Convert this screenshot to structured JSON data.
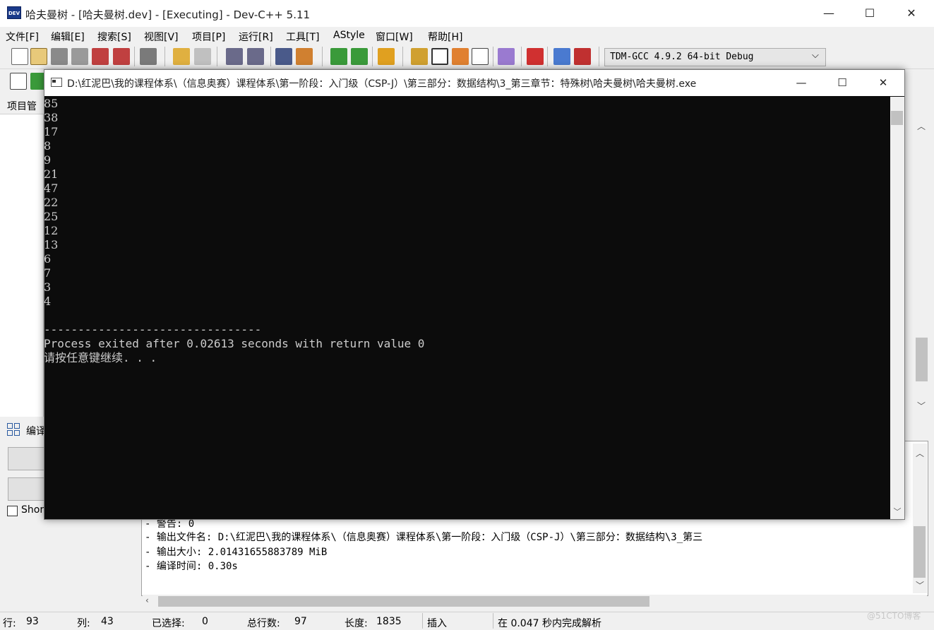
{
  "app": {
    "title": "哈夫曼树 - [哈夫曼树.dev] - [Executing] - Dev-C++ 5.11",
    "icon_text": "DEV"
  },
  "window_controls": {
    "minimize": "—",
    "maximize": "☐",
    "close": "✕"
  },
  "menu": [
    "文件[F]",
    "编辑[E]",
    "搜索[S]",
    "视图[V]",
    "项目[P]",
    "运行[R]",
    "工具[T]",
    "AStyle",
    "窗口[W]",
    "帮助[H]"
  ],
  "toolbar": {
    "compiler": "TDM-GCC 4.9.2 64-bit Debug"
  },
  "left_panel": {
    "project_tab": "项目管",
    "compile_log_tab": "编译",
    "short_checkbox": "Shor"
  },
  "console": {
    "title": "D:\\红泥巴\\我的课程体系\\（信息奥赛）课程体系\\第一阶段：入门级（CSP-J）\\第三部分：数据结构\\3_第三章节：特殊树\\哈夫曼树\\哈夫曼树.exe",
    "numbers": [
      "85",
      "38",
      "17",
      "8",
      "9",
      "21",
      "47",
      "22",
      "25",
      "12",
      "13",
      "6",
      "7",
      "3",
      "4"
    ],
    "separator": "--------------------------------",
    "process_line": "Process exited after 0.02613 seconds with return value 0",
    "press_key": "请按任意键继续. . ."
  },
  "compile_log": [
    "- 警告: 0",
    "- 输出文件名: D:\\红泥巴\\我的课程体系\\（信息奥赛）课程体系\\第一阶段：入门级（CSP-J）\\第三部分：数据结构\\3_第三",
    "- 输出大小: 2.01431655883789 MiB",
    "- 编译时间: 0.30s"
  ],
  "status": {
    "row_label": "行:",
    "row_value": "93",
    "col_label": "列:",
    "col_value": "43",
    "sel_label": "已选择:",
    "sel_value": "0",
    "lines_label": "总行数:",
    "lines_value": "97",
    "len_label": "长度:",
    "len_value": "1835",
    "mode": "插入",
    "parse": "在 0.047 秒内完成解析"
  },
  "watermark": "@51CTO博客",
  "colors": {
    "console_bg": "#0c0c0c",
    "console_fg": "#cccccc",
    "chrome": "#f0f0f0"
  }
}
